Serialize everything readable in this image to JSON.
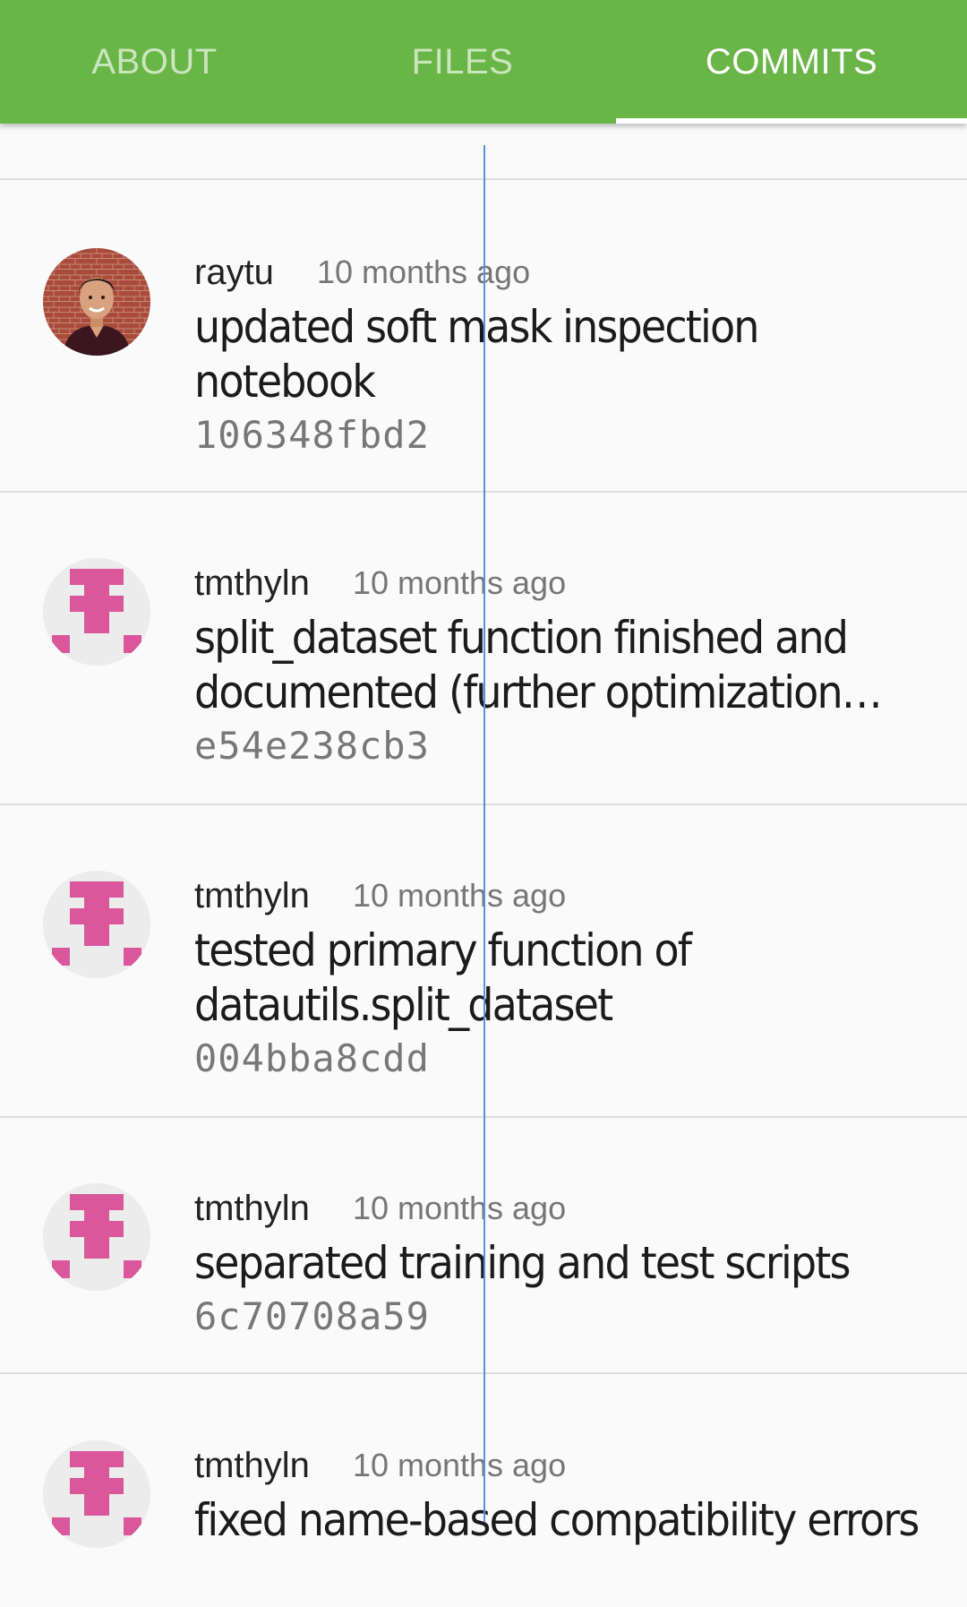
{
  "tabs": [
    {
      "label": "ABOUT",
      "active": false
    },
    {
      "label": "FILES",
      "active": false
    },
    {
      "label": "COMMITS",
      "active": true
    }
  ],
  "colors": {
    "header": "#6ab547",
    "identicon": "#d9579a",
    "identicon_bg": "#ececec",
    "guide": "#5a8fe0"
  },
  "commits": [
    {
      "author": "raytu",
      "time": "10 months ago",
      "message": "updated soft mask inspection notebook",
      "sha": "106348fbd2",
      "avatar": "photo"
    },
    {
      "author": "tmthyln",
      "time": "10 months ago",
      "message": "split_dataset function finished and documented (further optimization possible)",
      "sha": "e54e238cb3",
      "avatar": "identicon"
    },
    {
      "author": "tmthyln",
      "time": "10 months ago",
      "message": "tested primary function of datautils.split_dataset",
      "sha": "004bba8cdd",
      "avatar": "identicon"
    },
    {
      "author": "tmthyln",
      "time": "10 months ago",
      "message": "separated training and test scripts",
      "sha": "6c70708a59",
      "avatar": "identicon"
    },
    {
      "author": "tmthyln",
      "time": "10 months ago",
      "message": "fixed name-based compatibility errors",
      "sha": "",
      "avatar": "identicon"
    }
  ]
}
